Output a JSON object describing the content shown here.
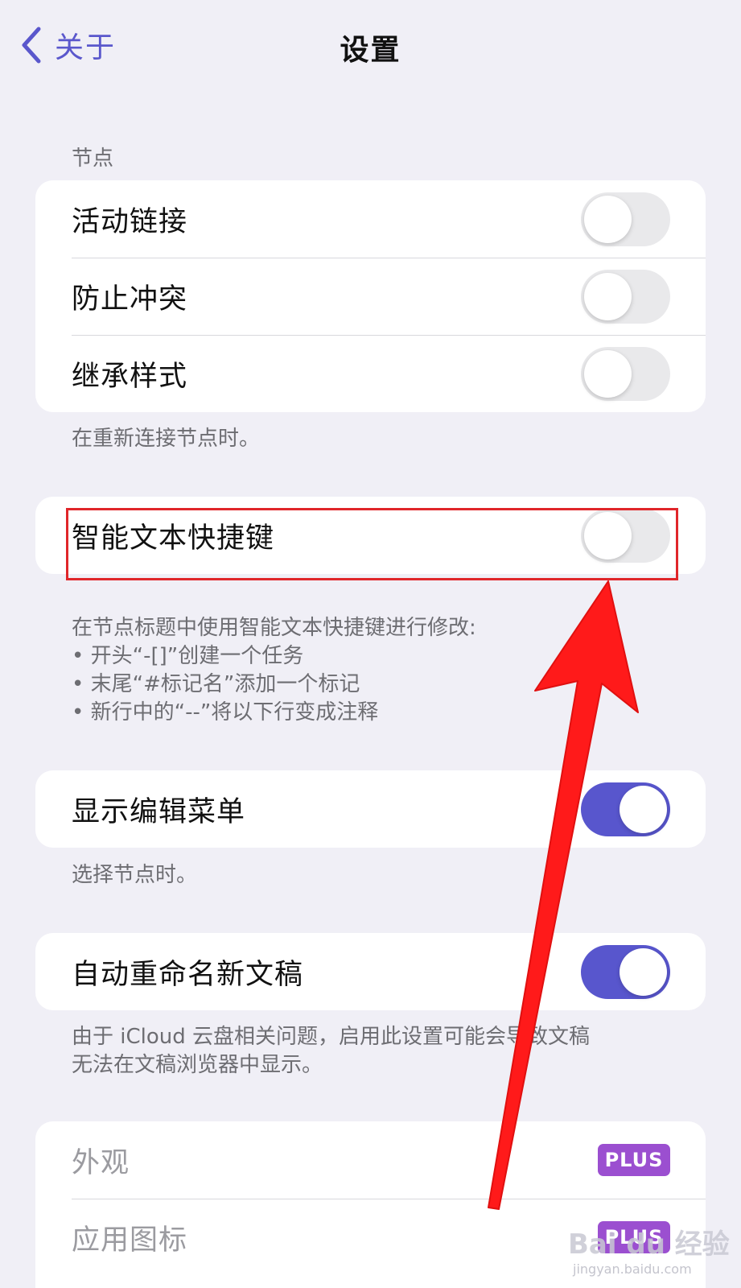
{
  "nav": {
    "back_label": "关于",
    "title": "设置"
  },
  "sections": {
    "nodes": {
      "header": "节点",
      "rows": [
        {
          "label": "活动链接",
          "on": false
        },
        {
          "label": "防止冲突",
          "on": false
        },
        {
          "label": "继承样式",
          "on": false
        }
      ],
      "footer": "在重新连接节点时。"
    },
    "smart_text": {
      "rows": [
        {
          "label": "智能文本快捷键",
          "on": false
        }
      ],
      "footer": "在节点标题中使用智能文本快捷键进行修改:\n• 开头“-[]”创建一个任务\n• 末尾“#标记名”添加一个标记\n• 新行中的“--”将以下行变成注释"
    },
    "edit_menu": {
      "rows": [
        {
          "label": "显示编辑菜单",
          "on": true
        }
      ],
      "footer": "选择节点时。"
    },
    "auto_rename": {
      "rows": [
        {
          "label": "自动重命名新文稿",
          "on": true
        }
      ],
      "footer": "由于 iCloud 云盘相关问题，启用此设置可能会导致文稿\n无法在文稿浏览器中显示。"
    },
    "plus": {
      "rows": [
        {
          "label": "外观",
          "badge": "PLUS"
        },
        {
          "label": "应用图标",
          "badge": "PLUS"
        }
      ]
    }
  },
  "annotations": {
    "highlight_color": "#e0262a",
    "arrow_color": "#ff1a1a"
  },
  "watermark": {
    "text": "Bai du 经验",
    "sub": "jingyan.baidu.com"
  },
  "colors": {
    "accent": "#5856cd",
    "plus_badge": "#9b4fd0",
    "background": "#f0eff6"
  }
}
